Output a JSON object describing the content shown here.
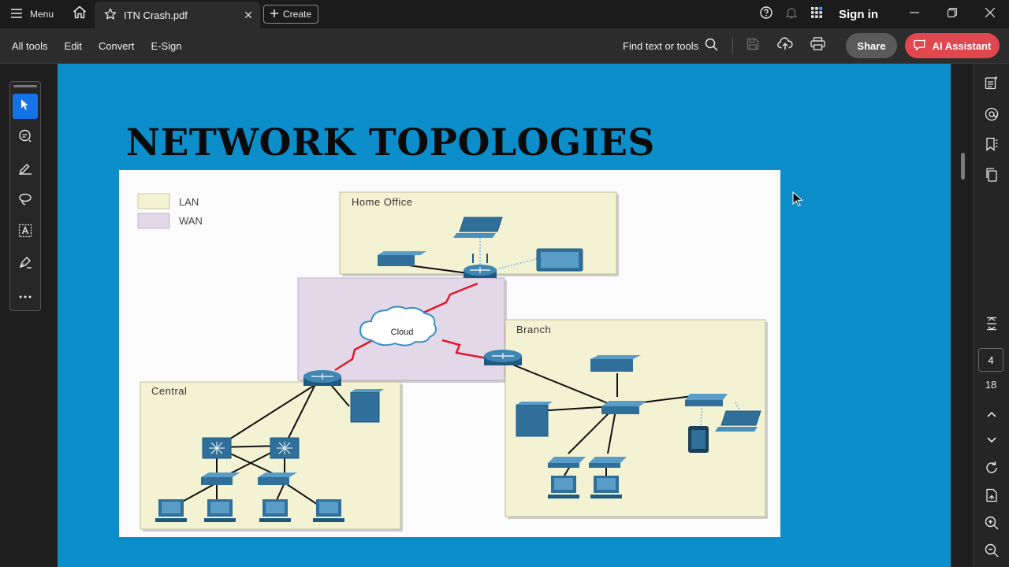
{
  "titlebar": {
    "menu_label": "Menu",
    "tab_title": "ITN Crash.pdf",
    "tab_close": "✕",
    "create_label": "Create",
    "sign_in": "Sign in"
  },
  "toolbar": {
    "menus": [
      "All tools",
      "Edit",
      "Convert",
      "E-Sign"
    ],
    "find_placeholder": "Find text or tools",
    "share_label": "Share",
    "ai_label": "AI Assistant"
  },
  "document": {
    "slide_title": "NETWORK TOPOLOGIES",
    "legend": [
      "LAN",
      "WAN"
    ],
    "zones": {
      "home_office": "Home Office",
      "branch": "Branch",
      "central": "Central",
      "cloud": "Cloud"
    }
  },
  "pagination": {
    "current_page": "4",
    "total_pages": "18"
  },
  "colors": {
    "page_bg": "#0c8ecb",
    "lan_fill": "#f3f3d3",
    "wan_fill": "#e3d8e7",
    "device_blue": "#2f6f99",
    "wan_link": "#e0182e",
    "accent_ai": "#e0474f",
    "active_tool": "#1473e6"
  }
}
